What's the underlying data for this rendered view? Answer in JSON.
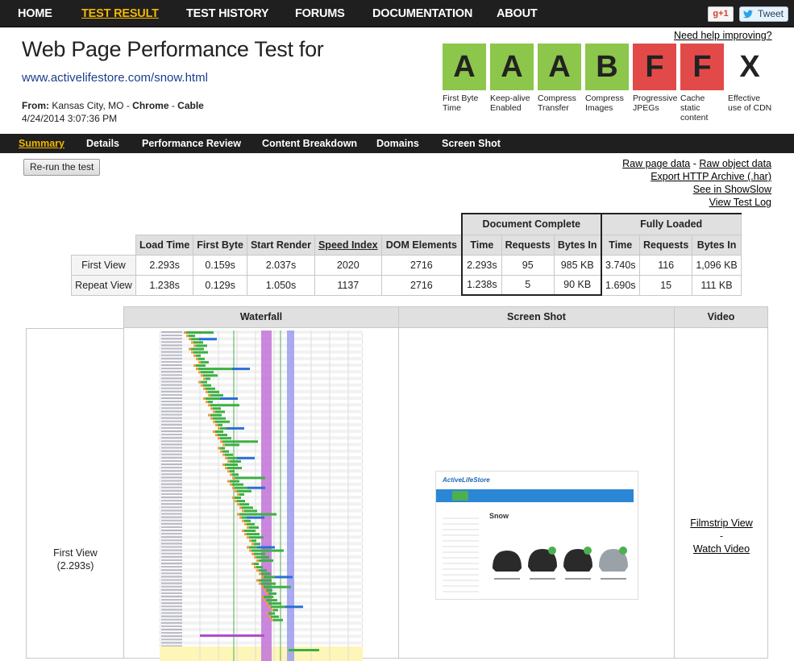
{
  "nav": {
    "items": [
      "HOME",
      "TEST RESULT",
      "TEST HISTORY",
      "FORUMS",
      "DOCUMENTATION",
      "ABOUT"
    ],
    "active": "TEST RESULT",
    "gplus_label": "g+1",
    "tweet_label": "Tweet"
  },
  "header": {
    "title": "Web Page Performance Test for",
    "url": "www.activelifestore.com/snow.html",
    "from_label": "From:",
    "from_location": "Kansas City, MO",
    "browser": "Chrome",
    "connection": "Cable",
    "date": "4/24/2014 3:07:36 PM",
    "help_link": "Need help improving?"
  },
  "grades": [
    {
      "grade": "A",
      "label": "First Byte Time",
      "status": "good"
    },
    {
      "grade": "A",
      "label": "Keep-alive Enabled",
      "status": "good"
    },
    {
      "grade": "A",
      "label": "Compress Transfer",
      "status": "good"
    },
    {
      "grade": "B",
      "label": "Compress Images",
      "status": "good"
    },
    {
      "grade": "F",
      "label": "Progressive JPEGs",
      "status": "bad"
    },
    {
      "grade": "F",
      "label": "Cache static content",
      "status": "bad"
    },
    {
      "grade": "X",
      "label": "Effective use of CDN",
      "status": "none"
    }
  ],
  "colors": {
    "good": "#8cc64b",
    "bad": "#e24a4a",
    "nav_bg": "#1f1f1f",
    "active_nav": "#f2b705"
  },
  "subnav": {
    "tabs": [
      "Summary",
      "Details",
      "Performance Review",
      "Content Breakdown",
      "Domains",
      "Screen Shot"
    ],
    "active": "Summary"
  },
  "actions": {
    "rerun": "Re-run the test",
    "raw_page": "Raw page data",
    "raw_sep": " - ",
    "raw_object": "Raw object data",
    "export_har": "Export HTTP Archive (.har)",
    "showslow": "See in ShowSlow",
    "test_log": "View Test Log"
  },
  "results": {
    "group_headers": [
      "Document Complete",
      "Fully Loaded"
    ],
    "columns": [
      "Load Time",
      "First Byte",
      "Start Render",
      "Speed Index",
      "DOM Elements",
      "Time",
      "Requests",
      "Bytes In",
      "Time",
      "Requests",
      "Bytes In"
    ],
    "rows": [
      {
        "label": "First View",
        "cells": [
          "2.293s",
          "0.159s",
          "2.037s",
          "2020",
          "2716",
          "2.293s",
          "95",
          "985 KB",
          "3.740s",
          "116",
          "1,096 KB"
        ]
      },
      {
        "label": "Repeat View",
        "cells": [
          "1.238s",
          "0.129s",
          "1.050s",
          "1137",
          "2716",
          "1.238s",
          "5",
          "90 KB",
          "1.690s",
          "15",
          "111 KB"
        ]
      }
    ]
  },
  "media": {
    "headers": [
      "Waterfall",
      "Screen Shot",
      "Video"
    ],
    "view_label": "First View",
    "view_time": "(2.293s)",
    "filmstrip": "Filmstrip View",
    "video_sep": "-",
    "watch_video": "Watch Video"
  },
  "screenshot": {
    "logo": "ActiveLifeStore",
    "heading": "Snow",
    "menu": [
      "SNOW",
      "CYCLING",
      "LIFESTYLE",
      "ACTIVEWEAR",
      "BRANDS"
    ]
  }
}
